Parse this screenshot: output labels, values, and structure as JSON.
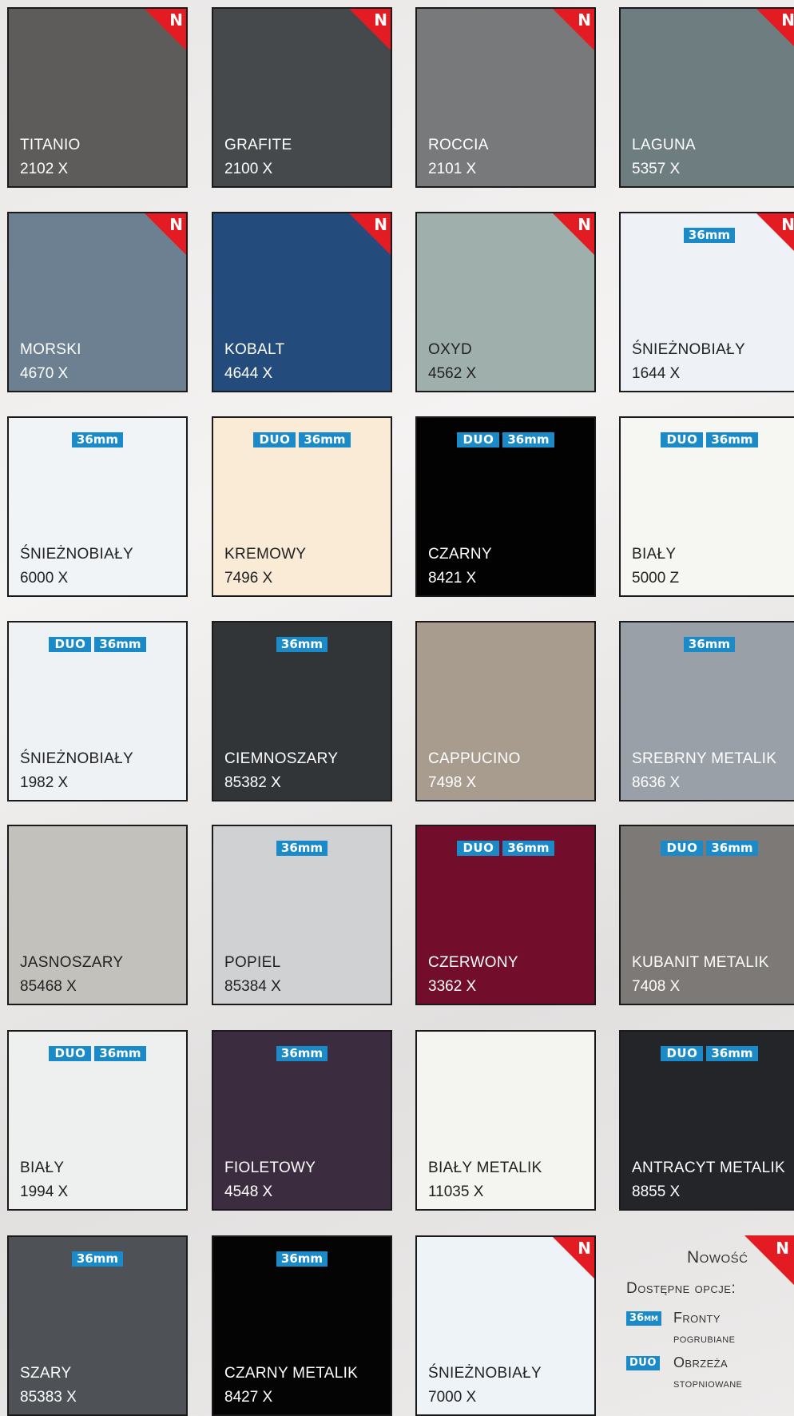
{
  "rows": [
    [
      {
        "name": "TITANIO",
        "code": "2102 X",
        "color": "#5d5c5b",
        "dark": true,
        "new": true,
        "badges": []
      },
      {
        "name": "GRAFITE",
        "code": "2100 X",
        "color": "#46494b",
        "dark": true,
        "new": true,
        "badges": []
      },
      {
        "name": "ROCCIA",
        "code": "2101 X",
        "color": "#78797a",
        "dark": true,
        "new": true,
        "badges": []
      },
      {
        "name": "LAGUNA",
        "code": "5357 X",
        "color": "#6e7e80",
        "dark": true,
        "new": true,
        "badges": []
      }
    ],
    [
      {
        "name": "MORSKI",
        "code": "4670 X",
        "color": "#6c8092",
        "dark": true,
        "new": true,
        "badges": []
      },
      {
        "name": "KOBALT",
        "code": "4644 X",
        "color": "#234c7d",
        "dark": true,
        "new": true,
        "badges": []
      },
      {
        "name": "OXYD",
        "code": "4562 X",
        "color": "#9fafab",
        "dark": false,
        "new": true,
        "badges": []
      },
      {
        "name": "ŚNIEŻNOBIAŁY",
        "code": "1644 X",
        "color": "#eef2f6",
        "dark": false,
        "new": true,
        "badges": [
          "36mm"
        ]
      }
    ],
    [
      {
        "name": "ŚNIEŻNOBIAŁY",
        "code": "6000 X",
        "color": "#f0f4f7",
        "dark": false,
        "new": false,
        "badges": [
          "36mm"
        ]
      },
      {
        "name": "KREMOWY",
        "code": "7496 X",
        "color": "#faebd7",
        "dark": false,
        "new": false,
        "badges": [
          "DUO",
          "36mm"
        ]
      },
      {
        "name": "CZARNY",
        "code": "8421 X",
        "color": "#020202",
        "dark": true,
        "new": false,
        "badges": [
          "DUO",
          "36mm"
        ]
      },
      {
        "name": "BIAŁY",
        "code": "5000 Z",
        "color": "#f6f6f3",
        "dark": false,
        "new": false,
        "badges": [
          "DUO",
          "36mm"
        ]
      }
    ],
    [
      {
        "name": "ŚNIEŻNOBIAŁY",
        "code": "1982 X",
        "color": "#eef2f5",
        "dark": false,
        "new": false,
        "badges": [
          "DUO",
          "36mm"
        ]
      },
      {
        "name": "CIEMNOSZARY",
        "code": "85382 X",
        "color": "#323538",
        "dark": true,
        "new": false,
        "badges": [
          "36mm"
        ]
      },
      {
        "name": "CAPPUCINO",
        "code": "7498 X",
        "color": "#a89c8f",
        "dark": true,
        "new": false,
        "badges": []
      },
      {
        "name": "SREBRNY METALIK",
        "code": "8636 X",
        "color": "#9aa0a8",
        "dark": true,
        "new": false,
        "badges": [
          "36mm"
        ]
      }
    ],
    [
      {
        "name": "JASNOSZARY",
        "code": "85468 X",
        "color": "#c3c1bc",
        "dark": false,
        "new": false,
        "badges": []
      },
      {
        "name": "POPIEL",
        "code": "85384 X",
        "color": "#d0d1d3",
        "dark": false,
        "new": false,
        "badges": [
          "36mm"
        ]
      },
      {
        "name": "CZERWONY",
        "code": "3362 X",
        "color": "#720e2c",
        "dark": true,
        "new": false,
        "badges": [
          "DUO",
          "36mm"
        ]
      },
      {
        "name": "KUBANIT METALIK",
        "code": "7408 X",
        "color": "#7c7976",
        "dark": true,
        "new": false,
        "badges": [
          "DUO",
          "36mm"
        ]
      }
    ],
    [
      {
        "name": "BIAŁY",
        "code": "1994 X",
        "color": "#eef0f0",
        "dark": false,
        "new": false,
        "badges": [
          "DUO",
          "36mm"
        ]
      },
      {
        "name": "FIOLETOWY",
        "code": "4548 X",
        "color": "#3c2c3f",
        "dark": true,
        "new": false,
        "badges": [
          "36mm"
        ]
      },
      {
        "name": "BIAŁY METALIK",
        "code": "11035 X",
        "color": "#f4f5f1",
        "dark": false,
        "new": false,
        "badges": []
      },
      {
        "name": "ANTRACYT METALIK",
        "code": "8855 X",
        "color": "#232528",
        "dark": true,
        "new": false,
        "badges": [
          "DUO",
          "36mm"
        ]
      }
    ],
    [
      {
        "name": "SZARY",
        "code": "85383 X",
        "color": "#4e5256",
        "dark": true,
        "new": false,
        "badges": [
          "36mm"
        ]
      },
      {
        "name": "CZARNY METALIK",
        "code": "8427 X",
        "color": "#040405",
        "dark": true,
        "new": false,
        "badges": [
          "36mm"
        ]
      },
      {
        "name": "ŚNIEŻNOBIAŁY",
        "code": "7000 X",
        "color": "#eef3f8",
        "dark": false,
        "new": true,
        "badges": []
      }
    ]
  ],
  "new_mark": "N",
  "accent_red": "#e31b23",
  "badge_blue": "#1b8ac9",
  "legend": {
    "new_label": "Nowość",
    "options_title": "Dostępne opcje:",
    "items": [
      {
        "badge": "36mm",
        "line1": "Fronty",
        "line2": "pogrubiane"
      },
      {
        "badge": "DUO",
        "line1": "Obrzeża",
        "line2": "stopniowane"
      }
    ]
  }
}
